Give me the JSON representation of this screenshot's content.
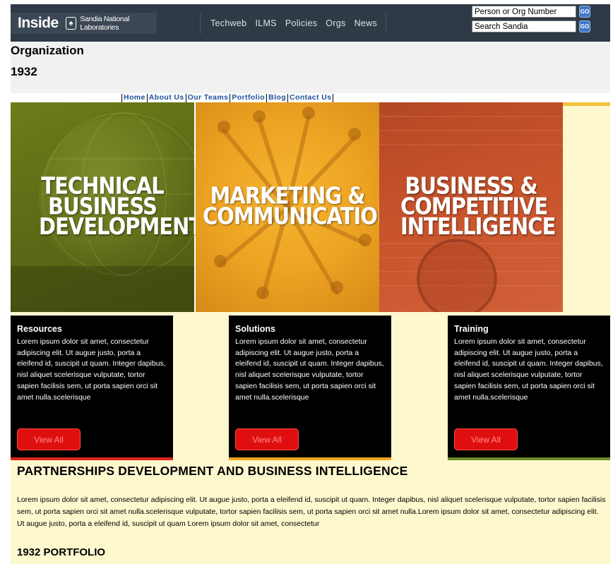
{
  "topbar": {
    "logo_inside": "Inside",
    "logo_org": "Sandia National Laboratories",
    "nav": [
      "Techweb",
      "ILMS",
      "Policies",
      "Orgs",
      "News"
    ],
    "search_person_placeholder": "Person or Org Number",
    "search_site_placeholder": "Search Sandia",
    "go_label": "GO"
  },
  "header": {
    "title": "Organization",
    "org_number": "1932"
  },
  "subnav": [
    "Home",
    "About Us",
    "Our Teams",
    "Portfolio",
    "Blog",
    "Contact Us"
  ],
  "banners": [
    {
      "title": "TECHNICAL BUSINESS DEVELOPMENT",
      "color": "#5f6e17"
    },
    {
      "title": "MARKETING & COMMUNICATIONS",
      "color": "#eda322"
    },
    {
      "title": "BUSINESS & COMPETITIVE INTELLIGENCE",
      "color": "#c9542c"
    }
  ],
  "cards": [
    {
      "title": "Resources",
      "body": "Lorem ipsum dolor sit amet, consectetur adipiscing elit. Ut augue justo, porta a eleifend id, suscipit ut quam. Integer dapibus, nisl aliquet scelerisque vulputate, tortor sapien facilisis sem, ut porta sapien orci sit amet nulla.scelerisque",
      "button": "View All",
      "accent": "#e0241a"
    },
    {
      "title": "Solutions",
      "body": "Lorem ipsum dolor sit amet, consectetur adipiscing elit. Ut augue justo, porta a eleifend id, suscipit ut quam. Integer dapibus, nisl aliquet scelerisque vulputate, tortor sapien facilisis sem, ut porta sapien orci sit amet nulla.scelerisque",
      "button": "View All",
      "accent": "#f2a51e"
    },
    {
      "title": "Training",
      "body": "Lorem ipsum dolor sit amet, consectetur adipiscing elit. Ut augue justo, porta a eleifend id, suscipit ut quam. Integer dapibus, nisl aliquet scelerisque vulputate, tortor sapien facilisis sem, ut porta sapien orci sit amet nulla.scelerisque",
      "button": "View All",
      "accent": "#6e8a2a"
    }
  ],
  "section": {
    "title": "PARTNERSHIPS DEVELOPMENT AND BUSINESS INTELLIGENCE",
    "body": "Lorem ipsum dolor sit amet, consectetur adipiscing elit. Ut augue justo, porta a eleifend id, suscipit ut quam. Integer dapibus, nisl aliquet scelerisque vulputate, tortor sapien facilisis sem, ut porta sapien orci sit amet nulla.scelerisque vulputate, tortor sapien facilisis sem, ut porta sapien orci sit amet nulla.Lorem ipsum dolor sit amet, consectetur adipiscing elit. Ut augue justo, porta a eleifend id, suscipit ut quam Lorem ipsum dolor sit amet, consectetur",
    "portfolio_title": "1932 PORTFOLIO"
  }
}
